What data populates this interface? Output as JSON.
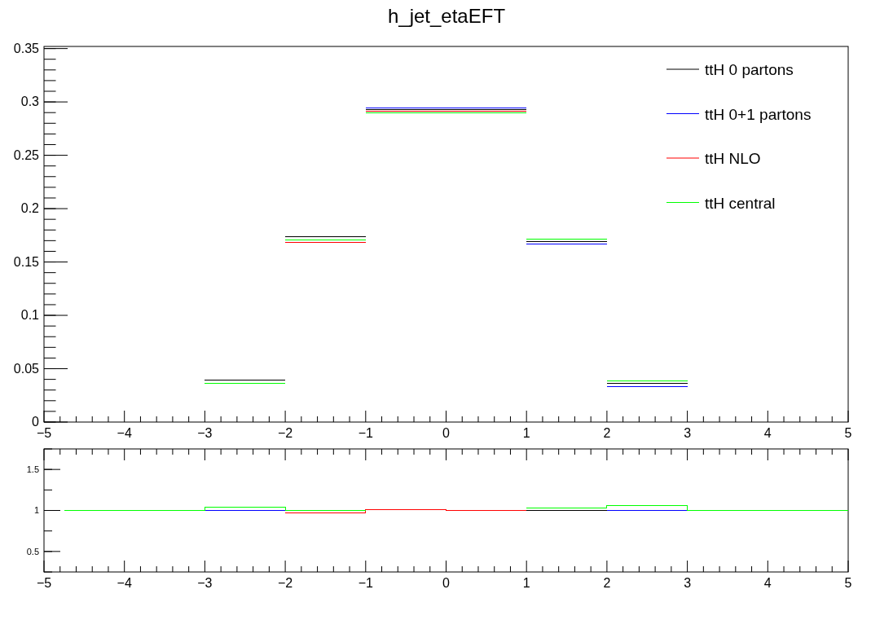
{
  "main": {
    "chart_data": {
      "type": "line",
      "title": "h_jet_etaEFT",
      "legend": true,
      "x": [
        -3,
        -2,
        -2,
        -1,
        -1,
        0,
        0,
        1,
        1,
        2,
        2,
        3
      ],
      "xlim": [
        -5,
        5
      ],
      "ylim": [
        0,
        0.352
      ],
      "xticks": [
        -5,
        -4,
        -3,
        -2,
        -1,
        0,
        1,
        2,
        3,
        4,
        5
      ],
      "yticks": [
        0,
        0.05,
        0.1,
        0.15,
        0.2,
        0.25,
        0.3,
        0.35
      ],
      "series": [
        {
          "name": "ttH 0 partons",
          "color": "#000000",
          "values": [
            0.039,
            0.039,
            0.1735,
            0.1735,
            0.293,
            0.293,
            0.293,
            0.293,
            0.169,
            0.169,
            0.036,
            0.036
          ]
        },
        {
          "name": "ttH 0+1 partons",
          "color": "#0000ff",
          "values": [
            null,
            null,
            null,
            null,
            0.2945,
            0.2945,
            0.2945,
            0.2945,
            0.1665,
            0.1665,
            0.0335,
            0.0335
          ]
        },
        {
          "name": "ttH NLO",
          "color": "#ff0000",
          "values": [
            null,
            null,
            0.1685,
            0.1685,
            0.2915,
            0.2915,
            0.2915,
            0.2915,
            null,
            null,
            null,
            null
          ]
        },
        {
          "name": "ttH central",
          "color": "#00ff00",
          "values": [
            0.0365,
            0.0365,
            0.171,
            0.171,
            0.29,
            0.29,
            0.29,
            0.29,
            0.1715,
            0.1715,
            0.0385,
            0.0385
          ]
        }
      ]
    }
  },
  "ratio": {
    "chart_data": {
      "type": "line",
      "x": [
        -4.75,
        -3,
        -3,
        -2,
        -2,
        -1,
        -1,
        0,
        0,
        1,
        1,
        2,
        2,
        3,
        3,
        5
      ],
      "xlim": [
        -5,
        5
      ],
      "ylim": [
        0.25,
        1.75
      ],
      "xticks": [
        -5,
        -4,
        -3,
        -2,
        -1,
        0,
        1,
        2,
        3,
        4,
        5
      ],
      "yticks": [
        {
          "value": 0.5,
          "label": "0.5"
        },
        {
          "value": 1,
          "label": "1"
        },
        {
          "value": 1.5,
          "label": "1.5"
        }
      ],
      "series": [
        {
          "color": "#000000",
          "values": [
            null,
            null,
            null,
            null,
            null,
            null,
            null,
            null,
            null,
            null,
            1,
            1,
            null,
            null,
            null,
            null
          ]
        },
        {
          "color": "#0000ff",
          "values": [
            null,
            null,
            1,
            1,
            null,
            null,
            null,
            null,
            null,
            null,
            null,
            null,
            1,
            1,
            null,
            null
          ]
        },
        {
          "color": "#ff0000",
          "values": [
            null,
            null,
            null,
            null,
            0.97,
            0.97,
            1.01,
            1.01,
            1,
            1,
            null,
            null,
            null,
            null,
            null,
            null
          ]
        },
        {
          "color": "#00ff00",
          "values": [
            1,
            1,
            1.04,
            1.04,
            1,
            1,
            null,
            null,
            null,
            null,
            1.03,
            1.03,
            1.06,
            1.06,
            1,
            1
          ]
        }
      ]
    }
  }
}
